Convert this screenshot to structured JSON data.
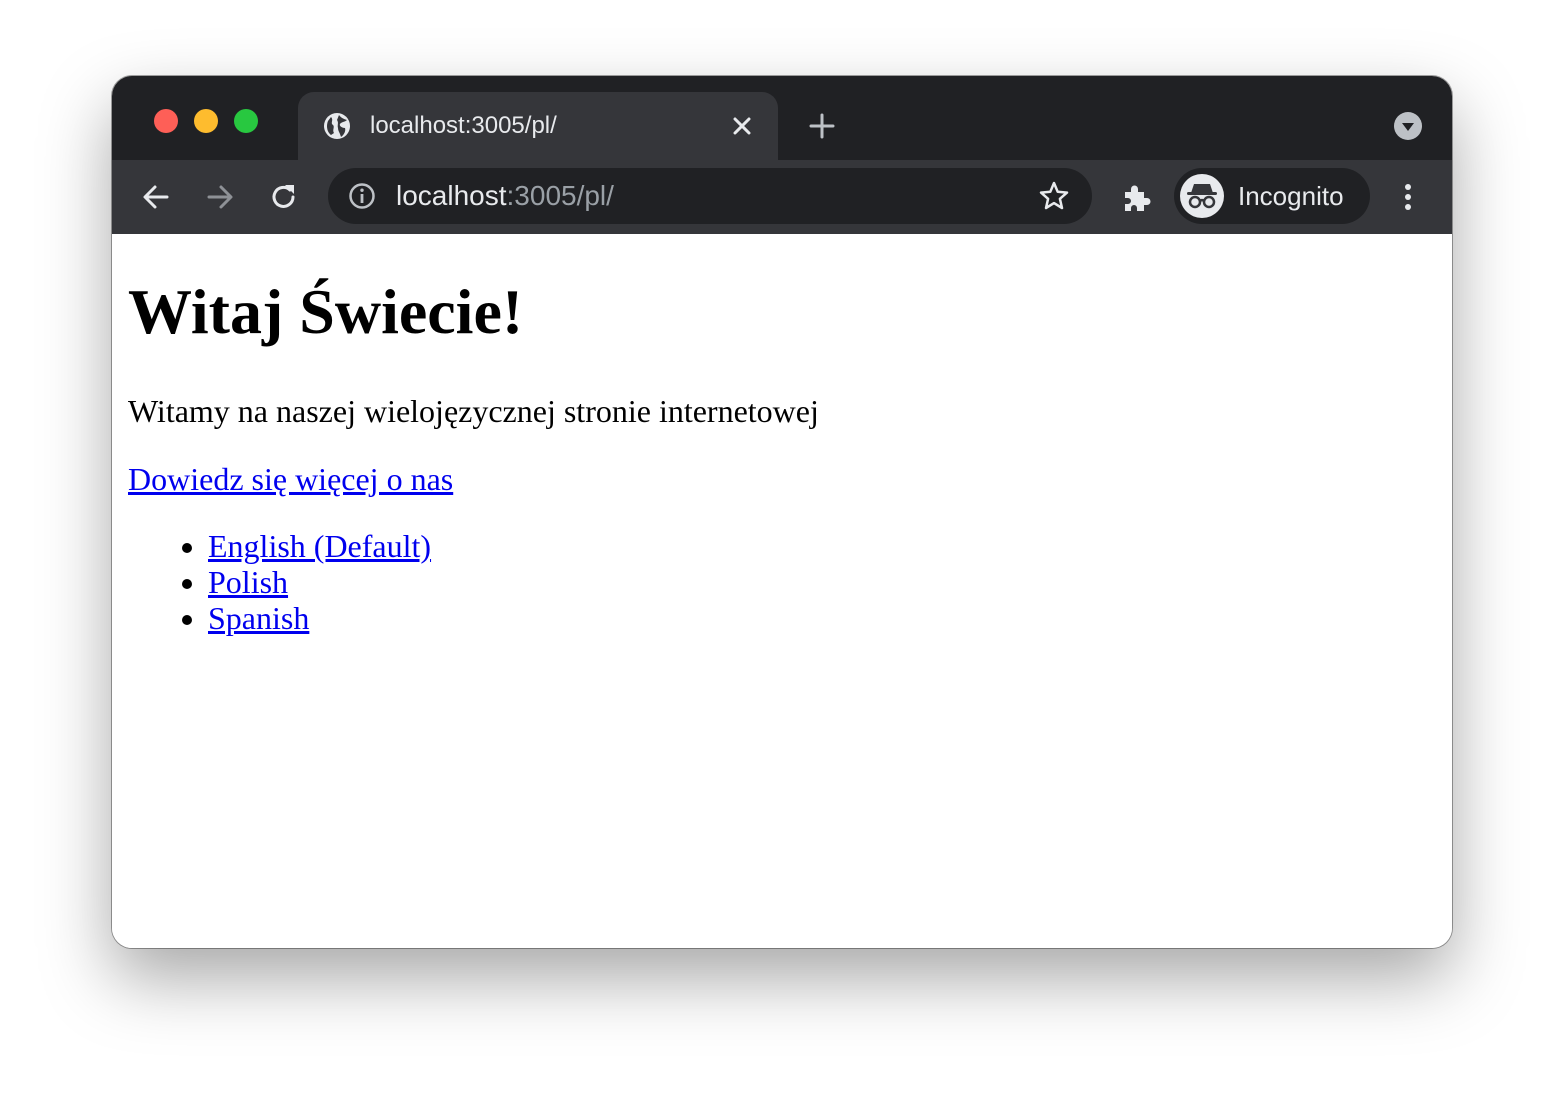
{
  "browser": {
    "tab": {
      "title": "localhost:3005/pl/"
    },
    "omnibox": {
      "host": "localhost",
      "rest": ":3005/pl/"
    },
    "profile": {
      "label": "Incognito"
    },
    "icons": {
      "back": "arrow-back-icon",
      "forward": "arrow-forward-icon",
      "reload": "reload-icon",
      "info": "info-icon",
      "bookmark": "star-icon",
      "extensions": "puzzle-icon",
      "menu": "kebab-menu-icon",
      "favicon": "globe-icon",
      "new_tab": "plus-icon",
      "tab_search": "chevron-down-circle-icon"
    },
    "colors": {
      "tabstrip": "#202124",
      "toolbar": "#35363a",
      "close": "#fe5f57",
      "minimize": "#febc2e",
      "maximize": "#28c840"
    }
  },
  "page": {
    "heading": "Witaj Świecie!",
    "intro": "Witamy na naszej wielojęzycznej stronie internetowej",
    "about_link": "Dowiedz się więcej o nas",
    "languages": [
      {
        "label": "English (Default)"
      },
      {
        "label": "Polish"
      },
      {
        "label": "Spanish"
      }
    ],
    "link_color": "#0000ee"
  }
}
